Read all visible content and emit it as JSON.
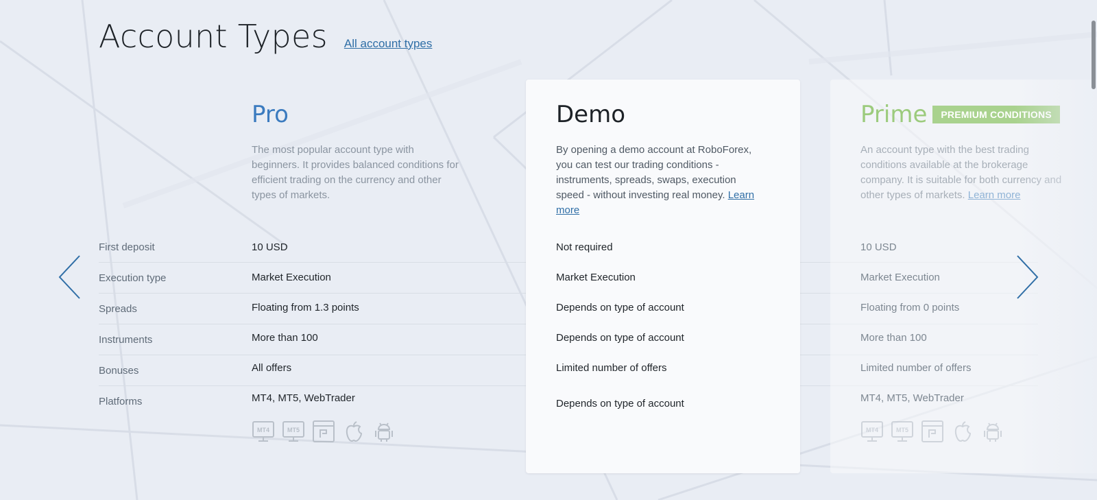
{
  "heading": {
    "title": "Account Types",
    "all_link": "All account types"
  },
  "rows": {
    "first_deposit": "First deposit",
    "execution_type": "Execution type",
    "spreads": "Spreads",
    "instruments": "Instruments",
    "bonuses": "Bonuses",
    "platforms": "Platforms"
  },
  "cards": {
    "pro": {
      "title": "Pro",
      "description": "The most popular account type with beginners. It provides balanced conditions for efficient trading on the currency and other types of markets.",
      "first_deposit": "10 USD",
      "execution_type": "Market Execution",
      "spreads": "Floating from 1.3 points",
      "instruments": "More than 100",
      "bonuses": "All offers",
      "platforms": "MT4,  MT5,  WebTrader",
      "platform_icons": [
        "mt4-icon",
        "mt5-icon",
        "webtrader-icon",
        "apple-icon",
        "android-icon"
      ]
    },
    "demo": {
      "title": "Demo",
      "description": "By opening a demo account at RoboForex, you can test our trading conditions - instruments, spreads, swaps, execution speed - without investing real money.",
      "learn_more": "Learn more",
      "first_deposit": "Not required",
      "execution_type": "Market Execution",
      "spreads": "Depends on type of account",
      "instruments": "Depends on type of account",
      "bonuses": "Limited number of offers",
      "platforms": "Depends on type of account"
    },
    "prime": {
      "title": "Prime",
      "badge": "PREMIUM CONDITIONS",
      "description": "An account type with the best trading conditions available at the brokerage company. It is suitable for both currency and other types of markets.",
      "learn_more": "Learn more",
      "first_deposit": "10 USD",
      "execution_type": "Market Execution",
      "spreads": "Floating from 0 points",
      "instruments": "More than 100",
      "bonuses": "Limited number of offers",
      "platforms": "MT4,  MT5,  WebTrader",
      "platform_icons": [
        "mt4-icon",
        "mt5-icon",
        "webtrader-icon",
        "apple-icon",
        "android-icon"
      ]
    }
  },
  "icon_labels": {
    "mt4": "MT4",
    "mt5": "MT5"
  },
  "colors": {
    "pro_title": "#3b7bbf",
    "prime_title": "#9ccb7d",
    "link": "#2f6ea6",
    "arrow": "#2f6ea6"
  }
}
